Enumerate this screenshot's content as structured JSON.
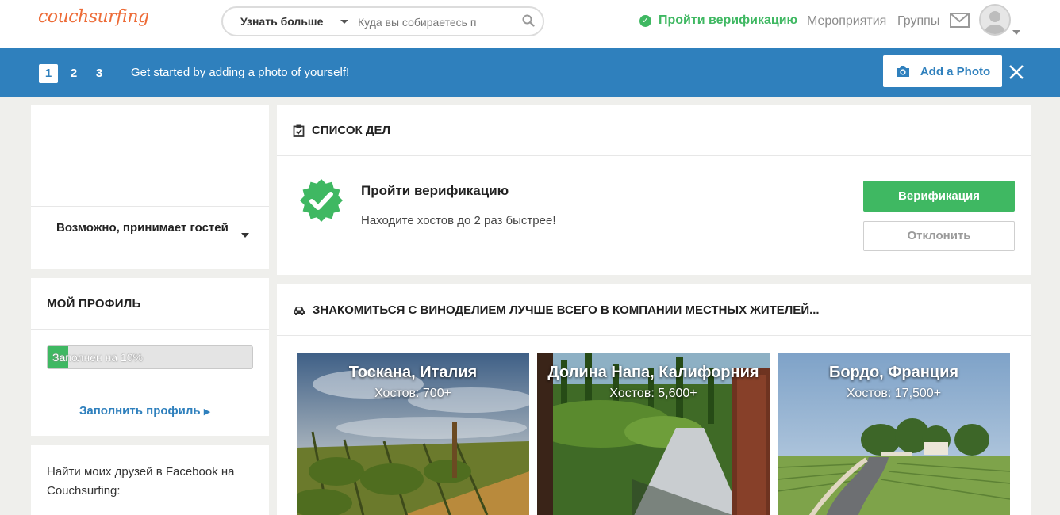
{
  "brand": {
    "logo_text": "couchsurfing",
    "accent": "#ed6b37"
  },
  "search": {
    "learn_more": "Узнать больше",
    "placeholder": "Куда вы собираетесь п"
  },
  "nav": {
    "verify": "Пройти верификацию",
    "events": "Мероприятия",
    "groups": "Группы"
  },
  "banner": {
    "steps": [
      "1",
      "2",
      "3"
    ],
    "active_step": "1",
    "text": "Get started by adding a photo of yourself!",
    "add_photo": "Add a Photo",
    "color": "#2f80bd"
  },
  "profile_card": {
    "hosting_status": "Возможно, принимает гостей"
  },
  "my_profile": {
    "title": "МОЙ ПРОФИЛЬ",
    "progress_label": "Заполнен на 10%",
    "progress": 0.1,
    "fill_link": "Заполнить профиль"
  },
  "facebook": {
    "text": "Найти моих друзей в Facebook на Couchsurfing:"
  },
  "todo": {
    "title": "СПИСОК ДЕЛ",
    "item_title": "Пройти верификацию",
    "item_subtitle": "Находите хостов до 2 раз быстрее!",
    "verify_button": "Верификация",
    "decline_button": "Отклонить"
  },
  "wine": {
    "title": "ЗНАКОМИТЬСЯ С ВИНОДЕЛИЕМ ЛУЧШЕ ВСЕГО В КОМПАНИИ МЕСТНЫХ ЖИТЕЛЕЙ...",
    "destinations": [
      {
        "name": "Тоскана, Италия",
        "hosts": "Хостов: 700+"
      },
      {
        "name": "Долина Напа, Калифорния",
        "hosts": "Хостов: 5,600+"
      },
      {
        "name": "Бордо, Франция",
        "hosts": "Хостов: 17,500+"
      }
    ]
  },
  "colors": {
    "green": "#3fb862",
    "blue": "#2f80bd",
    "background": "#efefec"
  }
}
